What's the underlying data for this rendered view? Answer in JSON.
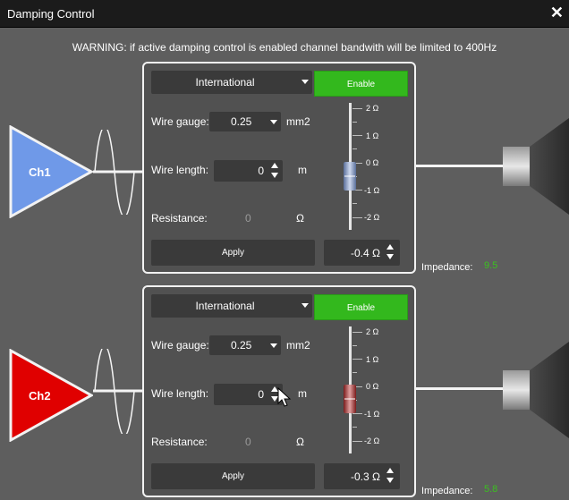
{
  "window": {
    "title": "Damping Control",
    "close_glyph": "✕"
  },
  "warning": "WARNING: if active damping control is enabled channel bandwith will be limited to 400Hz",
  "colors": {
    "enable_green": "#33b81d",
    "ch1_blue": "#6f99e8",
    "ch2_red": "#e00000",
    "impedance_green": "#3bc11f"
  },
  "channels": [
    {
      "name": "Ch1",
      "standard": "International",
      "enable_label": "Enable",
      "wire_gauge_label": "Wire gauge:",
      "wire_gauge_value": "0.25",
      "wire_gauge_unit": "mm2",
      "wire_length_label": "Wire length:",
      "wire_length_value": "0",
      "wire_length_unit": "m",
      "resistance_label": "Resistance:",
      "resistance_value": "0",
      "resistance_unit": "Ω",
      "apply_label": "Apply",
      "damping_value": "-0.4 Ω",
      "slider_thumb": "blue-thumb",
      "slider_level_ohm": -0.4,
      "impedance_label": "Impedance:",
      "impedance_value": "9.5"
    },
    {
      "name": "Ch2",
      "standard": "International",
      "enable_label": "Enable",
      "wire_gauge_label": "Wire gauge:",
      "wire_gauge_value": "0.25",
      "wire_gauge_unit": "mm2",
      "wire_length_label": "Wire length:",
      "wire_length_value": "0",
      "wire_length_unit": "m",
      "resistance_label": "Resistance:",
      "resistance_value": "0",
      "resistance_unit": "Ω",
      "apply_label": "Apply",
      "damping_value": "-0.3 Ω",
      "slider_thumb": "red-thumb",
      "slider_level_ohm": -0.3,
      "impedance_label": "Impedance:",
      "impedance_value": "5.8"
    }
  ],
  "slider_scale": [
    "2 Ω",
    "1 Ω",
    "0 Ω",
    "-1 Ω",
    "-2 Ω"
  ]
}
